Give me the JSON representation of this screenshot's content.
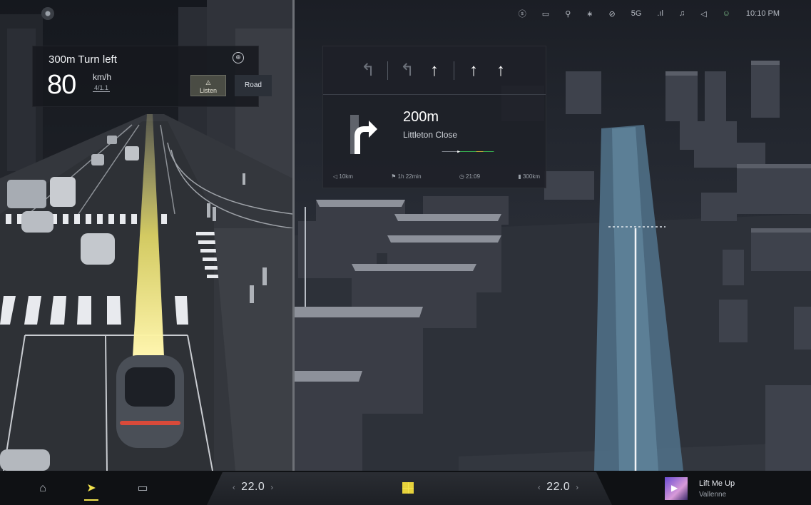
{
  "left_panel": {
    "instruction": "300m Turn left",
    "speed": "80",
    "speed_unit": "km/h",
    "speed_sub": "4/1.1",
    "listen_button": "Listen",
    "road_button": "Road"
  },
  "status_bar": {
    "icons": [
      "steering-icon",
      "camera-icon",
      "location-icon",
      "bluetooth-icon",
      "wifi-off-icon",
      "5G",
      "signal-icon",
      "bell-icon",
      "volume-icon",
      "user-icon"
    ],
    "network": "5G",
    "signal": ".ıl",
    "time": "10:10 PM"
  },
  "navigation": {
    "lanes": [
      "↰",
      "↰",
      "↑",
      "↑",
      "↑"
    ],
    "distance": "200m",
    "street": "Littleton Close",
    "trip": {
      "remaining_distance": "10km",
      "remaining_time": "1h 22min",
      "arrival": "21:09",
      "range": "300km"
    },
    "progress_colors": [
      "#9aa0a8",
      "#3fd65a",
      "#f1d23b",
      "#3fd65a"
    ]
  },
  "dock": {
    "left_temp": "22.0",
    "right_temp": "22.0",
    "track_title": "Lift Me Up",
    "track_artist": "Vallenne"
  },
  "colors": {
    "accent": "#f2e34d",
    "route_blue": "#4f6f86",
    "trajectory": "#f0e56a"
  }
}
